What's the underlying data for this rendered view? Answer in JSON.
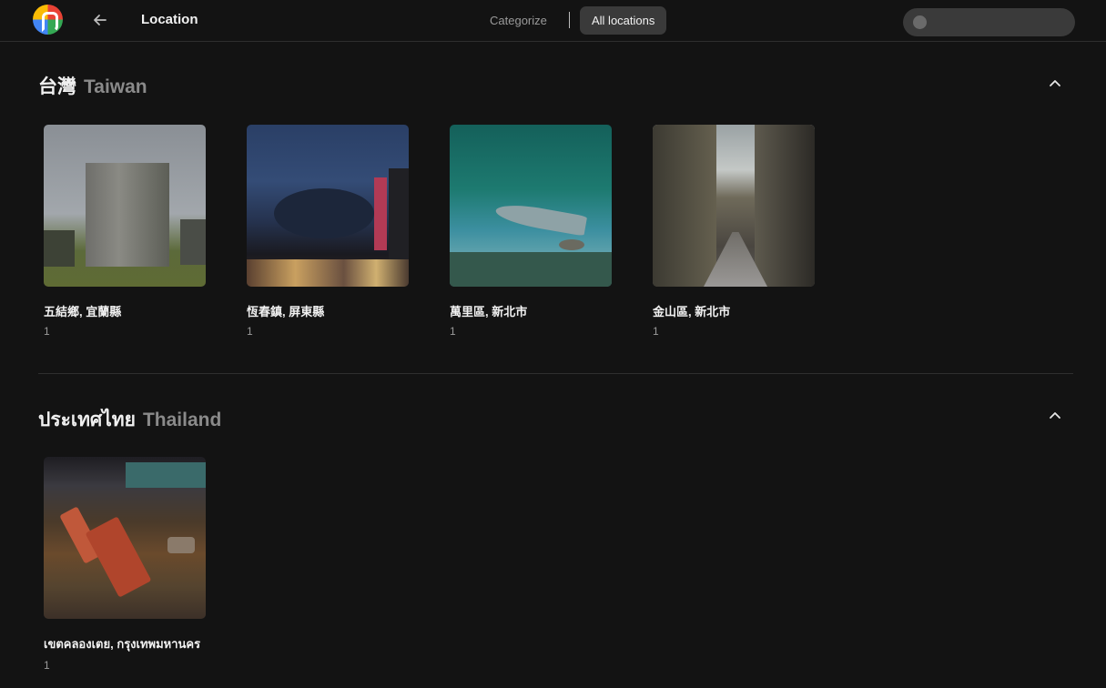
{
  "header": {
    "title": "Location",
    "tabs": [
      {
        "label": "Categorize",
        "active": false
      },
      {
        "label": "All locations",
        "active": true
      }
    ],
    "search_placeholder": ""
  },
  "sections": [
    {
      "title_native": "台灣",
      "title_en": "Taiwan",
      "items": [
        {
          "name": "五結鄉, 宜蘭縣",
          "count": "1"
        },
        {
          "name": "恆春鎮, 屏東縣",
          "count": "1"
        },
        {
          "name": "萬里區, 新北市",
          "count": "1"
        },
        {
          "name": "金山區, 新北市",
          "count": "1"
        }
      ]
    },
    {
      "title_native": "ประเทศไทย",
      "title_en": "Thailand",
      "items": [
        {
          "name": "เขตคลองเตย, กรุงเทพมหานคร",
          "count": "1"
        }
      ]
    }
  ],
  "colors": {
    "background": "#131313",
    "tab_active_bg": "#3a3a3a",
    "muted_text": "#8a8a8a"
  }
}
